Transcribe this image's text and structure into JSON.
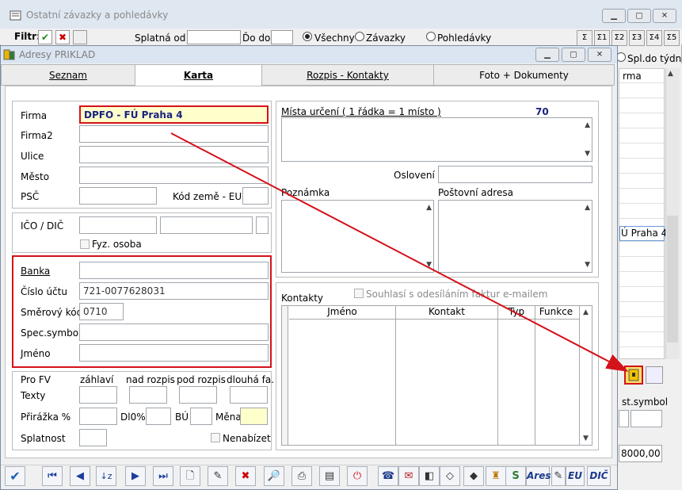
{
  "bg_window": {
    "title": "Ostatní závazky a pohledávky",
    "filter_label": "Filtr:",
    "splatna_od": "Splatná od",
    "do_label": "Ďo do",
    "radio_vsechny": "Všechny",
    "radio_zavazky": "Závazky",
    "radio_pohledavky": "Pohledávky",
    "sigma_buttons": [
      "Σ",
      "Σ1",
      "Σ2",
      "Σ3",
      "Σ4",
      "Σ5"
    ],
    "col_spl_tydne": "Spl.do týdne",
    "col_firma_partial": "rma",
    "row_firma_partial": "Ú Praha 4",
    "spec_symbol_label": "st.symbol",
    "amount": "8000,00"
  },
  "dialog": {
    "title": "Adresy PRIKLAD",
    "tabs": [
      {
        "label": "Seznam",
        "active": false
      },
      {
        "label": "Karta",
        "active": true
      },
      {
        "label": "Rozpis - Kontakty",
        "active": false
      },
      {
        "label": "Foto + Dokumenty",
        "active": false
      }
    ]
  },
  "address": {
    "firma_label": "Firma",
    "firma_value": "DPFO - FÚ Praha 4",
    "firma2_label": "Firma2",
    "ulice_label": "Ulice",
    "mesto_label": "Město",
    "psc_label": "PSČ",
    "kod_zeme_label": "Kód země - EU"
  },
  "ico": {
    "ico_label": "IČO / DIČ",
    "fyz_osoba_label": "Fyz. osoba"
  },
  "bank": {
    "banka_label": "Banka",
    "cislo_uctu_label": "Číslo účtu",
    "cislo_uctu_value": "721-0077628031",
    "smerovy_kod_label": "Směrový kód",
    "smerovy_kod_value": "0710",
    "spec_symbol_label": "Spec.symbol",
    "jmeno_label": "Jméno"
  },
  "fv": {
    "pro_fv_label": "Pro FV",
    "texty_label": "Texty",
    "zahlavi": "záhlaví",
    "nad_rozpis": "nad rozpis",
    "pod_rozpis": "pod rozpis",
    "dlouha_fa": "dlouhá fa.",
    "prirazka_label": "Přirážka %",
    "dl0_label": "Dl0%",
    "bu_label": "BÚ",
    "mena_label": "Měna",
    "splatnost_label": "Splatnost",
    "nenabizet_label": "Nenabízet"
  },
  "right": {
    "mista_label": "Místa určení ( 1 řádka = 1 místo )",
    "mista_count": "70",
    "osloveni_label": "Oslovení",
    "poznamka_label": "Poznámka",
    "postovni_label": "Poštovní adresa",
    "kontakty_label": "Kontakty",
    "souhlas_label": "Souhlasí s odesíláním faktur e-mailem",
    "contacts_columns": [
      "Jméno",
      "Kontakt",
      "Typ",
      "Funkce"
    ]
  },
  "toolbar": {
    "ares_label": "Ares",
    "eu_label": "EU",
    "dic_label": "DIČ",
    "icons": [
      "check-icon",
      "first-record-icon",
      "prev-record-icon",
      "sort-icon",
      "next-record-icon",
      "last-record-icon",
      "new-document-icon",
      "edit-icon",
      "delete-icon",
      "search-records-icon",
      "print-icon",
      "scanner-icon",
      "power-icon",
      "phone-icon",
      "mail-icon",
      "web-icon",
      "map-cz-icon",
      "map-cz2-icon",
      "bottle-icon",
      "s-logo-icon"
    ]
  },
  "colors": {
    "annotation_red": "#d4121a",
    "highlight_fill": "#ffffcc",
    "firma_text": "#1a237e"
  }
}
